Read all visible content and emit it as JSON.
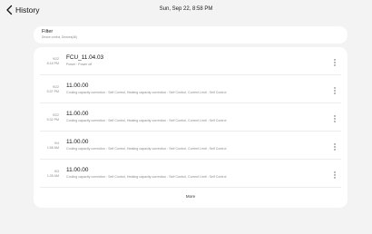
{
  "header": {
    "back_label": "History",
    "datetime": "Sun, Sep 22, 8:58 PM"
  },
  "filter": {
    "title": "Filter",
    "subtitle": "Device control, Devices(All)"
  },
  "history": [
    {
      "date": "9/22",
      "time": "8:18 PM",
      "title": "FCU_11.04.03",
      "description": "Power : Power off"
    },
    {
      "date": "9/22",
      "time": "5:37 PM",
      "title": "11.00.00",
      "description": "Cooling capacity correction : Self Control, Heating capacity correction : Self Control, Current Limit : Self Control"
    },
    {
      "date": "9/22",
      "time": "5:32 PM",
      "title": "11.00.00",
      "description": "Cooling capacity correction : Self Control, Heating capacity correction : Self Control, Current Limit : Self Control"
    },
    {
      "date": "9/4",
      "time": "1:56 AM",
      "title": "11.00.00",
      "description": "Cooling capacity correction : Self Control, Heating capacity correction : Self Control, Current Limit : Self Control"
    },
    {
      "date": "9/3",
      "time": "1:35 AM",
      "title": "11.00.00",
      "description": "Cooling capacity correction : Self Control, Heating capacity correction : Self Control, Current Limit : Self Control"
    }
  ],
  "more_label": "More",
  "icons": {
    "back": "chevron-left-icon",
    "row_menu": "more-vertical-icon"
  }
}
